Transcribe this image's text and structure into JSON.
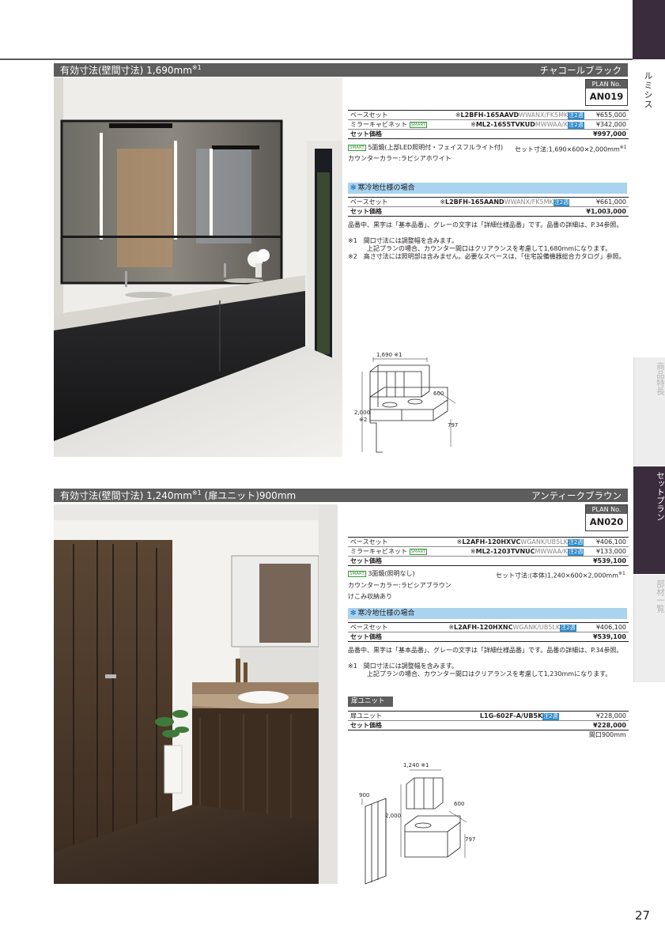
{
  "side": {
    "series": "ルミシス",
    "tab_features": "商品特長",
    "tab_set_plan": "セットプラン",
    "tab_parts": "部材一覧"
  },
  "page_number": "27",
  "sections": [
    {
      "title": "有効寸法(壁間寸法) 1,690mm",
      "title_sup": "※1",
      "title_extra": "",
      "color_name": "チャコールブラック",
      "plan_label": "PLAN No.",
      "plan_no": "AN019",
      "rows": [
        {
          "name": "ベースセット",
          "badge": "",
          "code_prefix": "※",
          "code_bold": "L2BFH-165AAVD",
          "code_gray": "WWANX/FK5MK",
          "tag": "注2週",
          "price": "¥655,000"
        },
        {
          "name": "ミラーキャビネット",
          "badge": "SMART",
          "code_prefix": "※",
          "code_bold": "ML2-1655TVKUD",
          "code_gray": "MWWAA/K",
          "tag": "注2週",
          "price": "¥342,000"
        }
      ],
      "total": {
        "name": "セット価格",
        "price": "¥997,000"
      },
      "mirror_badge": "SMART",
      "mirror_desc": "5面鏡(上部LED照明付・フェイスフルライト付)",
      "set_dims": "セット寸法:1,690×600×2,000mm",
      "set_dims_sup": "※1",
      "counter_color": "カウンターカラー:ラピシアホワイト",
      "extra_line": "",
      "cold_title": "寒冷地仕様の場合",
      "cold_rows": [
        {
          "name": "ベースセット",
          "code_prefix": "※",
          "code_bold": "L2BFH-165AAND",
          "code_gray": "WWANX/FK5MK",
          "tag": "注2週",
          "price": "¥661,000"
        }
      ],
      "cold_total": {
        "name": "セット価格",
        "price": "¥1,003,000"
      },
      "notes": [
        "品番中、黒字は「基本品番」、グレーの文字は「詳細仕様品番」です。品番の詳細は、P.34参照。",
        "※1　間口寸法には調整幅を含みます。",
        "　　　上記プランの場合、カウンター間口はクリアランスを考慮して1,680mmになります。",
        "※2　高さ寸法には照明部は含みません。必要なスペースは、「住宅設備機器総合カタログ」参照。"
      ],
      "diagram": {
        "width": "1,690 ※1",
        "depth": "600",
        "height": "2,000",
        "height_note": "※2",
        "counter": "797"
      }
    },
    {
      "title": "有効寸法(壁間寸法) 1,240mm",
      "title_sup": "※1",
      "title_extra": "(扉ユニット)900mm",
      "color_name": "アンティークブラウン",
      "plan_label": "PLAN No.",
      "plan_no": "AN020",
      "rows": [
        {
          "name": "ベースセット",
          "badge": "",
          "code_prefix": "※",
          "code_bold": "L2AFH-120HXVC",
          "code_gray": "WGANK/UB5LK",
          "tag": "注2週",
          "price": "¥406,100"
        },
        {
          "name": "ミラーキャビネット",
          "badge": "SMART",
          "code_prefix": "※",
          "code_bold": "ML2-1203TVNUC",
          "code_gray": "MWWAA/K",
          "tag": "注2週",
          "price": "¥133,000"
        }
      ],
      "total": {
        "name": "セット価格",
        "price": "¥539,100"
      },
      "mirror_badge": "SMART",
      "mirror_desc": "3面鏡(照明なし)",
      "set_dims": "セット寸法:(本体)1,240×600×2,000mm",
      "set_dims_sup": "※1",
      "counter_color": "カウンターカラー:ラピシアブラウン",
      "extra_line": "けこみ収納あり",
      "cold_title": "寒冷地仕様の場合",
      "cold_rows": [
        {
          "name": "ベースセット",
          "code_prefix": "※",
          "code_bold": "L2AFH-120HXNC",
          "code_gray": "WGANK/UB5LK",
          "tag": "注2週",
          "price": "¥406,100"
        }
      ],
      "cold_total": {
        "name": "セット価格",
        "price": "¥539,100"
      },
      "notes": [
        "品番中、黒字は「基本品番」、グレーの文字は「詳細仕様品番」です。品番の詳細は、P.34参照。",
        "※1　間口寸法には調整幅を含みます。",
        "　　　上記プランの場合、カウンター間口はクリアランスを考慮して1,230mmになります。"
      ],
      "door_unit": {
        "label": "扉ユニット",
        "row": {
          "name": "扉ユニット",
          "code": "L1G-602F-A/UB5K",
          "tag": "注2週",
          "price": "¥228,000"
        },
        "total": {
          "name": "セット価格",
          "price": "¥228,000"
        },
        "frontage": "間口900mm"
      },
      "diagram": {
        "width": "1,240 ※1",
        "depth": "600",
        "height": "2,000",
        "counter": "797",
        "door_width": "900"
      }
    }
  ],
  "colors": {
    "dark": "#3a2c3c",
    "title_bar": "#5d5d5d",
    "blue": "#a9d3ef",
    "tag_blue": "#2e8ac9"
  }
}
